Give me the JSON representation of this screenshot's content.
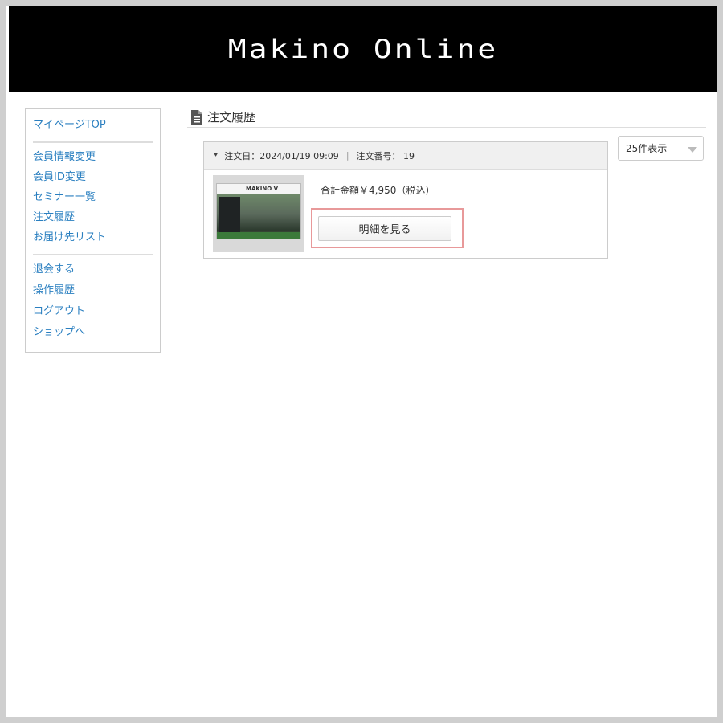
{
  "header": {
    "logo": "Makino Online"
  },
  "sidebar": {
    "groups": [
      [
        "マイページTOP"
      ],
      [
        "会員情報変更",
        "会員ID変更",
        "セミナー一覧",
        "注文履歴",
        "お届け先リスト"
      ],
      [
        "退会する",
        "操作履歴",
        "ログアウト",
        "ショップへ"
      ]
    ]
  },
  "main": {
    "title": "注文履歴",
    "per_page": "25件表示"
  },
  "order": {
    "date_label": "注文日：2024/01/19  09:09",
    "number_label": "注文番号： 19",
    "total": "合計金額￥4,950（税込）",
    "detail_button": "明細を見る"
  },
  "thumb": {
    "brand": "MAKINO V"
  },
  "colors": {
    "link": "#2a7fc0",
    "highlight": "#e8999a",
    "header_bg": "#000000"
  }
}
